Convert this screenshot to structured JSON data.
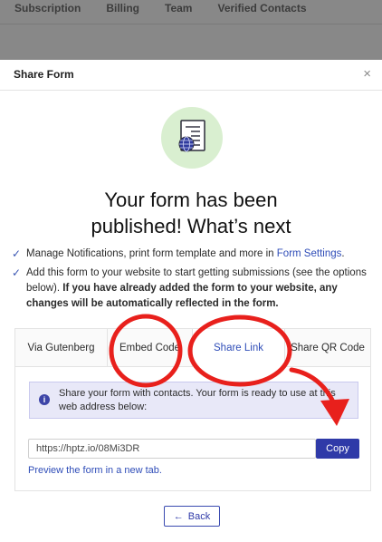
{
  "background": {
    "tabs": [
      "Subscription",
      "Billing",
      "Team",
      "Verified Contacts"
    ]
  },
  "modal": {
    "title": "Share Form",
    "close_icon": "×",
    "headline_line1": "Your form has been",
    "headline_line2": "published! What’s next",
    "checklist": {
      "item1_text": "Manage Notifications, print form template and more in ",
      "item1_link": "Form Settings",
      "item1_end": ".",
      "item2_text": "Add this form to your website to start getting submissions (see the options below). ",
      "item2_bold": "If you have already added the form to your website, any changes will be automatically reflected in the form."
    },
    "tabs": [
      {
        "label": "Via Gutenberg",
        "active": false
      },
      {
        "label": "Embed Code",
        "active": false
      },
      {
        "label": "Share Link",
        "active": true
      },
      {
        "label": "Share QR Code",
        "active": false
      }
    ],
    "info_text": "Share your form with contacts. Your form is ready to use at this web address below:",
    "url_value": "https://hptz.io/08Mi3DR",
    "copy_label": "Copy",
    "preview_link": "Preview the form in a new tab.",
    "back_label": "Back",
    "back_icon": "←"
  },
  "colors": {
    "accent": "#2f3aa8",
    "link": "#2f4db8",
    "annotation_red": "#e8201c",
    "illustration_bg": "#d9efd0"
  },
  "icons": {
    "illustration": "form-document-globe-icon",
    "check": "checkmark-icon",
    "info": "info-icon",
    "back": "arrow-left-icon"
  }
}
